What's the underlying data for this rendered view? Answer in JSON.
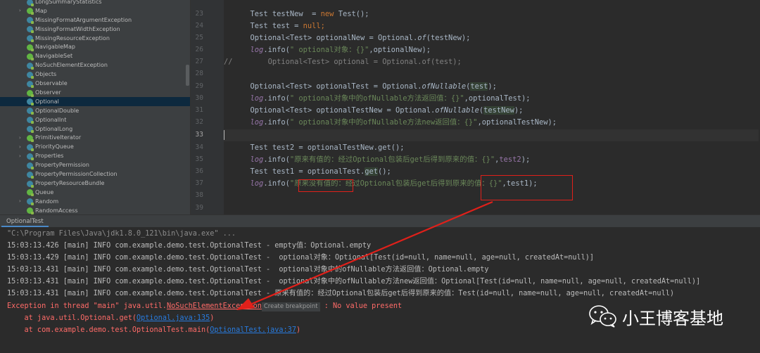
{
  "tree": {
    "items": [
      {
        "label": "LongSummaryStatistics",
        "icon": "class-icon",
        "arrow": false,
        "selected": false
      },
      {
        "label": "Map",
        "icon": "interface-icon",
        "arrow": true,
        "selected": false
      },
      {
        "label": "MissingFormatArgumentException",
        "icon": "class-icon",
        "arrow": false,
        "selected": false
      },
      {
        "label": "MissingFormatWidthException",
        "icon": "class-icon",
        "arrow": false,
        "selected": false
      },
      {
        "label": "MissingResourceException",
        "icon": "class-icon",
        "arrow": false,
        "selected": false
      },
      {
        "label": "NavigableMap",
        "icon": "interface-icon",
        "arrow": false,
        "selected": false
      },
      {
        "label": "NavigableSet",
        "icon": "interface-icon",
        "arrow": false,
        "selected": false
      },
      {
        "label": "NoSuchElementException",
        "icon": "class-icon",
        "arrow": false,
        "selected": false
      },
      {
        "label": "Objects",
        "icon": "class-icon",
        "arrow": false,
        "selected": false
      },
      {
        "label": "Observable",
        "icon": "class-icon",
        "arrow": false,
        "selected": false
      },
      {
        "label": "Observer",
        "icon": "interface-icon",
        "arrow": false,
        "selected": false
      },
      {
        "label": "Optional",
        "icon": "class-icon",
        "arrow": false,
        "selected": true
      },
      {
        "label": "OptionalDouble",
        "icon": "class-icon",
        "arrow": false,
        "selected": false
      },
      {
        "label": "OptionalInt",
        "icon": "class-icon",
        "arrow": false,
        "selected": false
      },
      {
        "label": "OptionalLong",
        "icon": "class-icon",
        "arrow": false,
        "selected": false
      },
      {
        "label": "PrimitiveIterator",
        "icon": "interface-icon",
        "arrow": true,
        "selected": false
      },
      {
        "label": "PriorityQueue",
        "icon": "class-icon",
        "arrow": true,
        "selected": false
      },
      {
        "label": "Properties",
        "icon": "class-icon",
        "arrow": true,
        "selected": false
      },
      {
        "label": "PropertyPermission",
        "icon": "class-icon",
        "arrow": false,
        "selected": false
      },
      {
        "label": "PropertyPermissionCollection",
        "icon": "class-icon",
        "arrow": false,
        "selected": false
      },
      {
        "label": "PropertyResourceBundle",
        "icon": "class-icon",
        "arrow": false,
        "selected": false
      },
      {
        "label": "Queue",
        "icon": "interface-icon",
        "arrow": false,
        "selected": false
      },
      {
        "label": "Random",
        "icon": "class-icon",
        "arrow": true,
        "selected": false
      },
      {
        "label": "RandomAccess",
        "icon": "interface-icon",
        "arrow": false,
        "selected": false
      }
    ]
  },
  "editor": {
    "line_numbers": [
      "23",
      "24",
      "25",
      "26",
      "27",
      "28",
      "29",
      "30",
      "31",
      "32",
      "33",
      "34",
      "35",
      "36",
      "37",
      "38",
      "39"
    ],
    "lines": {
      "l23": {
        "type": "Test testNew",
        "eq": "  = ",
        "kw": "new",
        "rest": " Test();"
      },
      "l24": {
        "a": "Test test = ",
        "kw": "null",
        "b": ";"
      },
      "l25": {
        "a": "Optional<Test> optionalNew = Optional.",
        "m": "of",
        "b": "(testNew);"
      },
      "l26": {
        "log": "log",
        "a": ".info(",
        "s": "\" optional对象：{}\"",
        "b": ",optionalNew);"
      },
      "l27": {
        "c1": "//",
        "c2": "Optional<Test> optional = Optional.of(test);"
      },
      "l29": {
        "a": "Optional<Test> optionalTest = Optional.",
        "m": "ofNullable",
        "p": "(",
        "h": "test",
        "b": ");"
      },
      "l30": {
        "log": "log",
        "a": ".info(",
        "s": "\" optional对象中的ofNullable方法返回值：{}\"",
        "b": ",optionalTest);"
      },
      "l31": {
        "a": "Optional<Test> optionalTestNew = Optional.",
        "m": "ofNullable",
        "p": "(",
        "h": "testNew",
        "b": ");"
      },
      "l32": {
        "log": "log",
        "a": ".info(",
        "s": "\" optional对象中的ofNullable方法new返回值：{}\"",
        "b": ",optionalTestNew);"
      },
      "l35": {
        "a": "Test test2 = optionalTestNew.get();"
      },
      "l36": {
        "log": "log",
        "a": ".info(",
        "s": "\"原来有值的：经过Optional包装后get后得到原来的值：{}\"",
        "b": ",",
        "v": "test2",
        "c": ");"
      },
      "l37": {
        "a": "Test test1 = optionalTest.",
        "h": "get",
        "b": "();"
      },
      "l38": {
        "log": "log",
        "a": ".info(",
        "s1": "\"原来没有值的",
        "s2": "：经过Optional包装后get后得到原来的值：{}\"",
        "b": ",test1);"
      }
    }
  },
  "run": {
    "tab_label": "OptionalTest",
    "console": {
      "cmd": "\"C:\\Program Files\\Java\\jdk1.8.0_121\\bin\\java.exe\" ...",
      "log_lines": [
        "15:03:13.426 [main] INFO com.example.demo.test.OptionalTest - empty值：Optional.empty",
        "15:03:13.429 [main] INFO com.example.demo.test.OptionalTest -  optional对象：Optional[Test(id=null, name=null, age=null, createdAt=null)]",
        "15:03:13.431 [main] INFO com.example.demo.test.OptionalTest -  optional对象中的ofNullable方法返回值：Optional.empty",
        "15:03:13.431 [main] INFO com.example.demo.test.OptionalTest -  optional对象中的ofNullable方法new返回值：Optional[Test(id=null, name=null, age=null, createdAt=null)]",
        "15:03:13.431 [main] INFO com.example.demo.test.OptionalTest - 原来有值的：经过Optional包装后get后得到原来的值：Test(id=null, name=null, age=null, createdAt=null)"
      ],
      "exception_prefix": "Exception in thread \"main\" java.util.",
      "exception_link": "NoSuchElementException",
      "breakpoint_hint": "Create breakpoint",
      "exception_suffix": " : No value present",
      "trace1_prefix": "    at java.util.Optional.get(",
      "trace1_link": "Optional.java:135",
      "trace1_suffix": ")",
      "trace2_prefix": "    at com.example.demo.test.OptionalTest.main(",
      "trace2_link": "OptionalTest.java:37",
      "trace2_suffix": ")"
    }
  },
  "watermark": {
    "text": "小王博客基地",
    "icon": "wechat-icon"
  },
  "colors": {
    "annotation_red": "#e0201a",
    "selection": "#0d293e",
    "string_green": "#6a8759",
    "keyword_orange": "#cc7832",
    "error_red": "#ff6b68",
    "link_blue": "#287bde"
  }
}
